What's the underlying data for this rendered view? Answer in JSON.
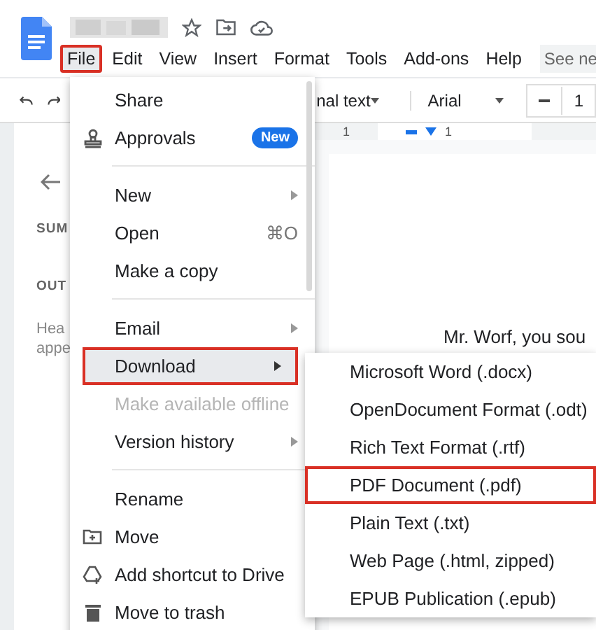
{
  "menu_bar": [
    {
      "label": "File",
      "selected": true,
      "annotated": true
    },
    {
      "label": "Edit",
      "selected": false,
      "annotated": false
    },
    {
      "label": "View",
      "selected": false,
      "annotated": false
    },
    {
      "label": "Insert",
      "selected": false,
      "annotated": false
    },
    {
      "label": "Format",
      "selected": false,
      "annotated": false
    },
    {
      "label": "Tools",
      "selected": false,
      "annotated": false
    },
    {
      "label": "Add-ons",
      "selected": false,
      "annotated": false
    },
    {
      "label": "Help",
      "selected": false,
      "annotated": false
    }
  ],
  "header_button": "See ne",
  "toolbar": {
    "style_dropdown": "nal text",
    "font_dropdown": "Arial",
    "font_size": "1"
  },
  "ruler": {
    "labels": [
      "1",
      "1"
    ]
  },
  "sidebar": {
    "summary_heading": "SUM",
    "outline_heading": "OUT",
    "hint_lines": [
      "Hea",
      "appe"
    ]
  },
  "document": {
    "lines": [
      "Mr. Worf, you sou"
    ]
  },
  "file_menu": [
    {
      "kind": "item",
      "label": "Share",
      "selected": false,
      "annotated": false,
      "disabled": false,
      "submenu": false
    },
    {
      "kind": "item",
      "label": "Approvals",
      "badge": "New",
      "selected": false,
      "annotated": false,
      "disabled": false,
      "submenu": false
    },
    {
      "kind": "divider"
    },
    {
      "kind": "item",
      "label": "New",
      "selected": false,
      "annotated": false,
      "disabled": false,
      "submenu": true
    },
    {
      "kind": "item",
      "label": "Open",
      "shortcut": "⌘O",
      "selected": false,
      "annotated": false,
      "disabled": false,
      "submenu": false
    },
    {
      "kind": "item",
      "label": "Make a copy",
      "selected": false,
      "annotated": false,
      "disabled": false,
      "submenu": false
    },
    {
      "kind": "divider"
    },
    {
      "kind": "item",
      "label": "Email",
      "selected": false,
      "annotated": false,
      "disabled": false,
      "submenu": true
    },
    {
      "kind": "item",
      "label": "Download",
      "selected": true,
      "annotated": true,
      "disabled": false,
      "submenu": true
    },
    {
      "kind": "item",
      "label": "Make available offline",
      "selected": false,
      "annotated": false,
      "disabled": true,
      "submenu": false
    },
    {
      "kind": "item",
      "label": "Version history",
      "selected": false,
      "annotated": false,
      "disabled": false,
      "submenu": true
    },
    {
      "kind": "divider"
    },
    {
      "kind": "item",
      "label": "Rename",
      "selected": false,
      "annotated": false,
      "disabled": false,
      "submenu": false
    },
    {
      "kind": "item",
      "label": "Move",
      "selected": false,
      "annotated": false,
      "disabled": false,
      "submenu": false
    },
    {
      "kind": "item",
      "label": "Add shortcut to Drive",
      "selected": false,
      "annotated": false,
      "disabled": false,
      "submenu": false
    },
    {
      "kind": "item",
      "label": "Move to trash",
      "selected": false,
      "annotated": false,
      "disabled": false,
      "submenu": false
    }
  ],
  "download_menu": [
    {
      "label": "Microsoft Word (.docx)",
      "selected": false,
      "annotated": false
    },
    {
      "label": "OpenDocument Format (.odt)",
      "selected": false,
      "annotated": false
    },
    {
      "label": "Rich Text Format (.rtf)",
      "selected": false,
      "annotated": false
    },
    {
      "label": "PDF Document (.pdf)",
      "selected": false,
      "annotated": true
    },
    {
      "label": "Plain Text (.txt)",
      "selected": false,
      "annotated": false
    },
    {
      "label": "Web Page (.html, zipped)",
      "selected": false,
      "annotated": false
    },
    {
      "label": "EPUB Publication (.epub)",
      "selected": false,
      "annotated": false
    }
  ]
}
